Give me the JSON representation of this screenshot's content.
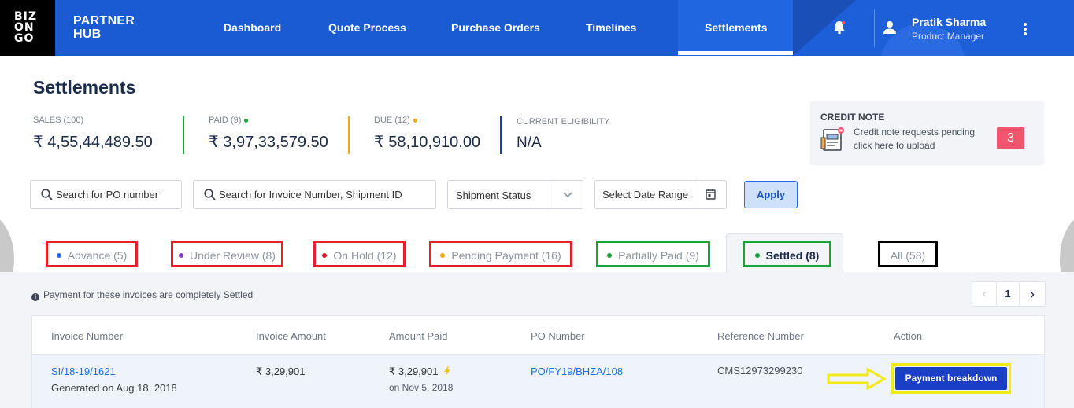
{
  "nav": {
    "logo": [
      "BIZ",
      "ON",
      "GO"
    ],
    "brand_line1": "PARTNER",
    "brand_line2": "HUB",
    "items": [
      "Dashboard",
      "Quote Process",
      "Purchase Orders",
      "Timelines",
      "Settlements"
    ],
    "active": "Settlements",
    "user_name": "Pratik Sharma",
    "user_role": "Product Manager"
  },
  "page": {
    "title": "Settlements"
  },
  "stats": [
    {
      "label": "SALES (100)",
      "value": "₹ 4,55,44,489.50",
      "color": ""
    },
    {
      "label": "PAID (9)",
      "value": "₹ 3,97,33,579.50",
      "color": "#1aa33a"
    },
    {
      "label": "DUE (12)",
      "value": "₹ 58,10,910.00",
      "color": "#f2a81c"
    },
    {
      "label": "CURRENT ELIGIBILITY",
      "value": "N/A",
      "color": "#1a3fb0"
    }
  ],
  "credit_note": {
    "title": "CREDIT NOTE",
    "line1": "Credit note requests pending",
    "line2": "click here to upload",
    "count": "3"
  },
  "filters": {
    "po_placeholder": "Search for PO number",
    "invoice_placeholder": "Search for Invoice Number, Shipment ID",
    "shipment_status": "Shipment Status",
    "date_range": "Select Date Range",
    "apply": "Apply"
  },
  "tabs": [
    {
      "label": "Advance (5)",
      "dot": "#2a6be4"
    },
    {
      "label": "Under Review (8)",
      "dot": "#8a3fd1"
    },
    {
      "label": "On Hold (12)",
      "dot": "#d0202a"
    },
    {
      "label": "Pending Payment (16)",
      "dot": "#f2a81c"
    },
    {
      "label": "Partially Paid (9)",
      "dot": "#1aa33a"
    },
    {
      "label": "Settled (8)",
      "dot": "#1aa33a"
    },
    {
      "label": "All (58)",
      "dot": ""
    }
  ],
  "info": "Payment for these invoices are completely Settled",
  "pager": {
    "current": "1"
  },
  "table": {
    "headers": [
      "Invoice Number",
      "Invoice Amount",
      "Amount Paid",
      "PO Number",
      "Reference Number",
      "Action"
    ],
    "rows": [
      {
        "invoice": "SI/18-19/1621",
        "generated": "Generated on Aug 18, 2018",
        "amount": "₹ 3,29,901",
        "paid": "₹ 3,29,901",
        "paid_on": "on Nov 5, 2018",
        "po": "PO/FY19/BHZA/108",
        "reference": "CMS12973299230",
        "action": "Payment breakdown"
      }
    ]
  }
}
